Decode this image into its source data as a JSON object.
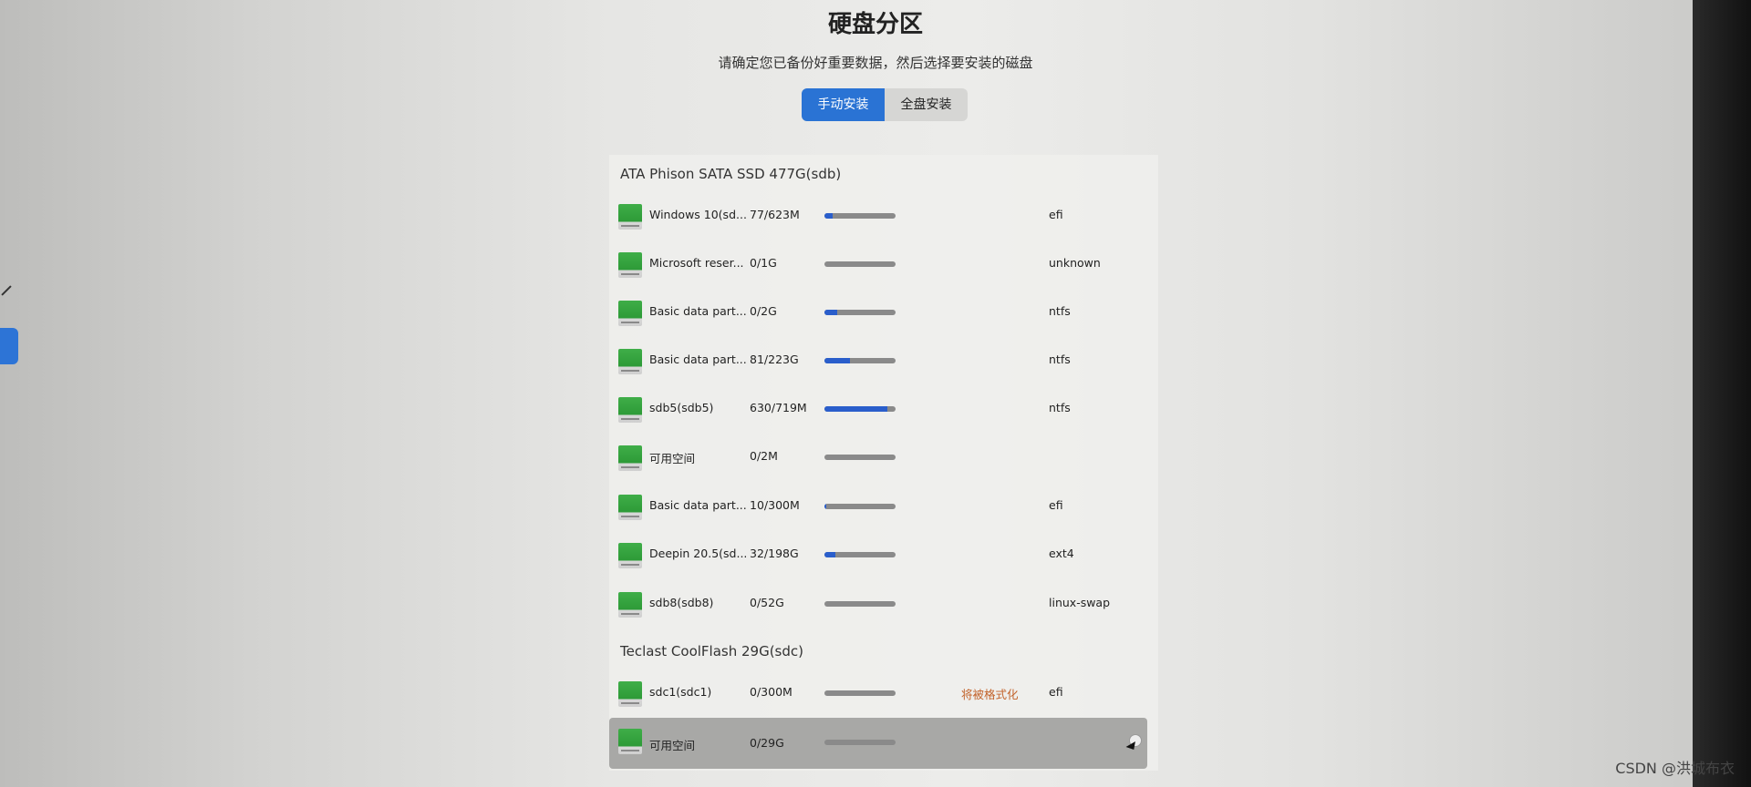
{
  "header": {
    "title": "硬盘分区",
    "subtitle": "请确定您已备份好重要数据，然后选择要安装的磁盘"
  },
  "tabs": [
    {
      "label": "手动安装",
      "active": true
    },
    {
      "label": "全盘安装",
      "active": false
    }
  ],
  "disks": [
    {
      "title": "ATA Phison SATA SSD 477G(sdb)",
      "partitions": [
        {
          "name": "Windows 10(sd...",
          "size": "77/623M",
          "used": 0.12,
          "fs": "efi",
          "format_label": ""
        },
        {
          "name": "Microsoft reser...",
          "size": "0/1G",
          "used": 0,
          "fs": "unknown",
          "format_label": ""
        },
        {
          "name": "Basic data part...",
          "size": "0/2G",
          "used": 0.18,
          "fs": "ntfs",
          "format_label": ""
        },
        {
          "name": "Basic data part...",
          "size": "81/223G",
          "used": 0.36,
          "fs": "ntfs",
          "format_label": ""
        },
        {
          "name": "sdb5(sdb5)",
          "size": "630/719M",
          "used": 0.88,
          "fs": "ntfs",
          "format_label": ""
        },
        {
          "name": "可用空间",
          "size": "0/2M",
          "used": 0,
          "fs": "",
          "format_label": ""
        },
        {
          "name": "Basic data part...",
          "size": "10/300M",
          "used": 0.03,
          "fs": "efi",
          "format_label": ""
        },
        {
          "name": "Deepin 20.5(sd...",
          "size": "32/198G",
          "used": 0.16,
          "fs": "ext4",
          "format_label": ""
        },
        {
          "name": "sdb8(sdb8)",
          "size": "0/52G",
          "used": 0,
          "fs": "linux-swap",
          "format_label": ""
        }
      ]
    },
    {
      "title": "Teclast CoolFlash 29G(sdc)",
      "partitions": [
        {
          "name": "sdc1(sdc1)",
          "size": "0/300M",
          "used": 0,
          "fs": "efi",
          "format_label": "将被格式化"
        },
        {
          "name": "可用空间",
          "size": "0/29G",
          "used": 0,
          "fs": "",
          "format_label": "",
          "selected": true
        }
      ]
    }
  ],
  "watermark": "CSDN @洪城布衣",
  "colors": {
    "accent": "#2a73d4",
    "usage_fill": "#2a5ecb",
    "format_warning": "#c2622a",
    "disk_icon": "#3fae48"
  }
}
